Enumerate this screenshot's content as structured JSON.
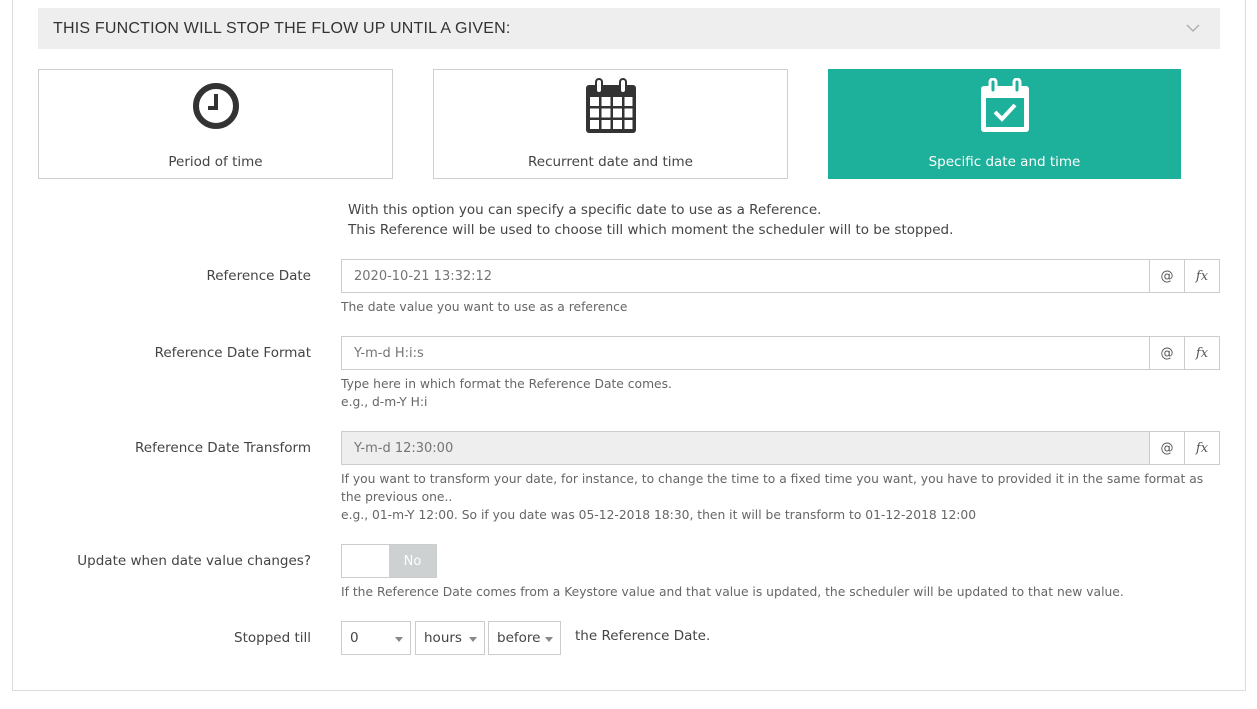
{
  "section": {
    "title": "THIS FUNCTION WILL STOP THE FLOW UP UNTIL A GIVEN:",
    "collapse_icon": "chevron-down-icon"
  },
  "options": [
    {
      "label": "Period of time",
      "icon": "clock-icon",
      "selected": false
    },
    {
      "label": "Recurrent date and time",
      "icon": "calendar-icon",
      "selected": false
    },
    {
      "label": "Specific date and time",
      "icon": "calendar-check-icon",
      "selected": true
    }
  ],
  "intro": {
    "line1": "With this option you can specify a specific date to use as a Reference.",
    "line2": "This Reference will be used to choose till which moment the scheduler will to be stopped."
  },
  "fields": {
    "reference_date": {
      "label": "Reference Date",
      "placeholder": "2020-10-21 13:32:12",
      "value": "",
      "help": "The date value you want to use as a reference"
    },
    "reference_date_format": {
      "label": "Reference Date Format",
      "placeholder": "Y-m-d H:i:s",
      "value": "",
      "help1": "Type here in which format the Reference Date comes.",
      "help2": "e.g., d-m-Y H:i"
    },
    "reference_date_transform": {
      "label": "Reference Date Transform",
      "placeholder": "Y-m-d 12:30:00",
      "value": "",
      "disabled": true,
      "help1": "If you want to transform your date, for instance, to change the time to a fixed time you want, you have to provided it in the same format as the previous one..",
      "help2": "e.g., 01-m-Y 12:00. So if you date was 05-12-2018 18:30, then it will be transform to 01-12-2018 12:00"
    },
    "update_on_change": {
      "label": "Update when date value changes?",
      "state": "No",
      "help": "If the Reference Date comes from a Keystore value and that value is updated, the scheduler will be updated to that new value."
    },
    "stopped_till": {
      "label": "Stopped till",
      "amount": "0",
      "unit": "hours",
      "direction": "before",
      "suffix": "the Reference Date."
    }
  },
  "addons": {
    "at": "@",
    "fx": "fx"
  },
  "colors": {
    "accent": "#1db09a",
    "header_bg": "#eeeeee",
    "toggle_off": "#cdd1d1"
  }
}
